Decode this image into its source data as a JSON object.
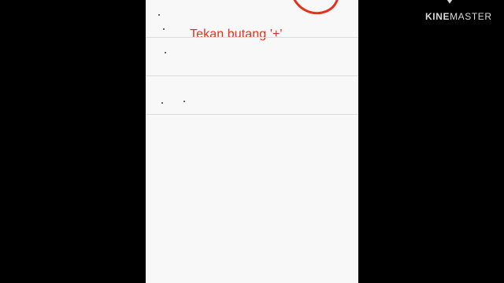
{
  "annotation": {
    "text": "Tekan butang '+'",
    "color": "#e8311c"
  },
  "watermark": {
    "prefix": "KINE",
    "suffix": "MASTER"
  },
  "colors": {
    "background": "#000000",
    "screen": "#f8f8f8",
    "divider": "#dcdcdc",
    "highlight": "#e8311c"
  }
}
